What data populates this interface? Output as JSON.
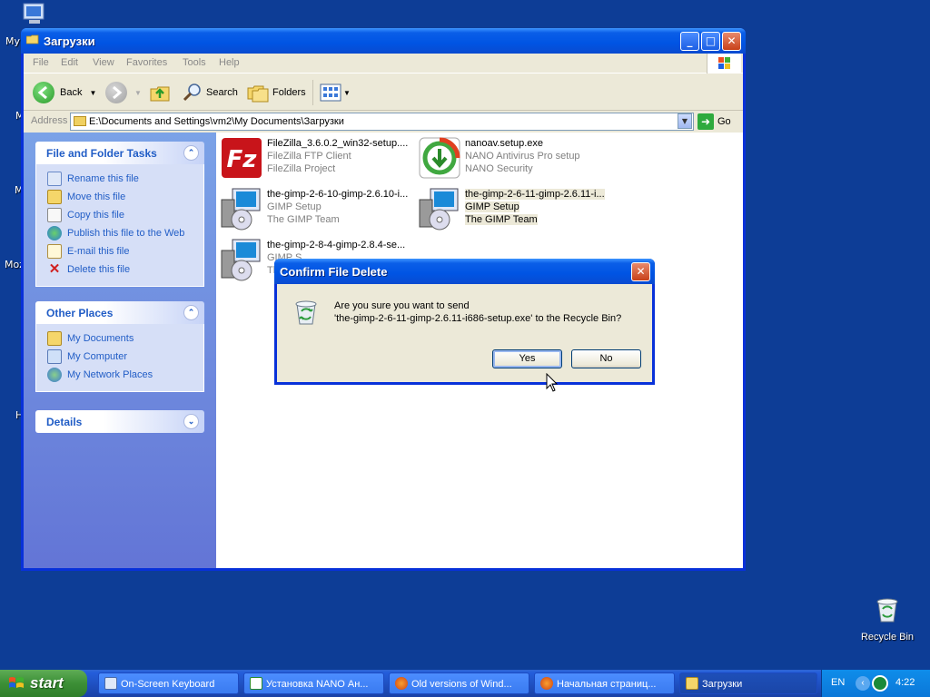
{
  "desktop": {
    "icon_labels": [
      "My",
      "M",
      "M",
      "Moz",
      "H"
    ],
    "recycle_bin": "Recycle Bin"
  },
  "window": {
    "title": "Загрузки",
    "menu": [
      "File",
      "Edit",
      "View",
      "Favorites",
      "Tools",
      "Help"
    ],
    "toolbar": {
      "back": "Back",
      "search": "Search",
      "folders": "Folders"
    },
    "address": {
      "label": "Address",
      "value": "E:\\Documents and Settings\\vm2\\My Documents\\Загрузки",
      "go": "Go"
    },
    "sidebar": {
      "file_tasks": {
        "title": "File and Folder Tasks",
        "items": [
          "Rename this file",
          "Move this file",
          "Copy this file",
          "Publish this file to the Web",
          "E-mail this file",
          "Delete this file"
        ]
      },
      "other_places": {
        "title": "Other Places",
        "items": [
          "My Documents",
          "My Computer",
          "My Network Places"
        ]
      },
      "details": {
        "title": "Details"
      }
    },
    "files": [
      {
        "name": "FileZilla_3.6.0.2_win32-setup....",
        "desc": "FileZilla FTP Client",
        "pub": "FileZilla Project",
        "icon": "filezilla-icon"
      },
      {
        "name": "nanoav.setup.exe",
        "desc": "NANO Antivirus Pro setup",
        "pub": "NANO Security",
        "icon": "nano-antivirus-icon"
      },
      {
        "name": "the-gimp-2-6-10-gimp-2.6.10-i...",
        "desc": "GIMP Setup",
        "pub": "The GIMP Team",
        "icon": "installer-icon"
      },
      {
        "name": "the-gimp-2-6-11-gimp-2.6.11-i...",
        "desc": "GIMP Setup",
        "pub": "The GIMP Team",
        "icon": "installer-icon"
      },
      {
        "name": "the-gimp-2-8-4-gimp-2.8.4-se...",
        "desc": "GIMP S...",
        "pub": "The...",
        "icon": "installer-icon"
      }
    ]
  },
  "dialog": {
    "title": "Confirm File Delete",
    "line1": "Are you sure you want to send",
    "line2": "'the-gimp-2-6-11-gimp-2.6.11-i686-setup.exe' to the Recycle Bin?",
    "yes": "Yes",
    "no": "No"
  },
  "taskbar": {
    "start": "start",
    "tasks": [
      "On-Screen Keyboard",
      "Установка NANO Ан...",
      "Old versions of Wind...",
      "Начальная страниц...",
      "Загрузки"
    ],
    "lang": "EN",
    "clock": "4:22"
  },
  "colors": {
    "desktop": "#0d3d96",
    "titlebar": "#0054e3",
    "sidebar_link": "#215dc6"
  }
}
